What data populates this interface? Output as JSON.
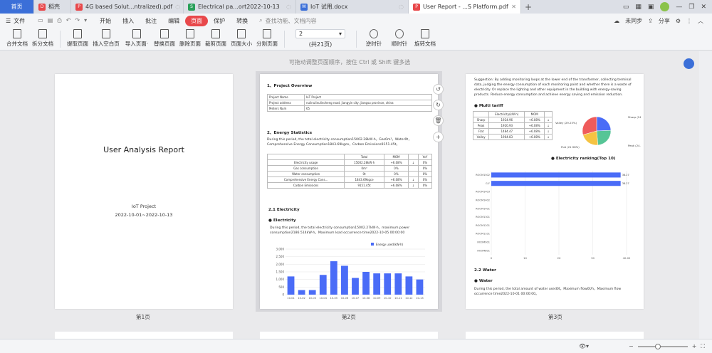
{
  "tabs": [
    {
      "label": "首页",
      "type": "home"
    },
    {
      "label": "稻壳",
      "icon_color": "#e8484b"
    },
    {
      "label": "4G based Solut...ntralized).pdf",
      "icon_color": "#e8484b"
    },
    {
      "label": "Electrical pa...ort2022-10-13",
      "icon_color": "#2aa05a"
    },
    {
      "label": "IoT 试用.docx",
      "icon_color": "#3b6fd8"
    },
    {
      "label": "User Report - ...S Platform.pdf",
      "icon_color": "#e8484b",
      "active": true
    }
  ],
  "menu": {
    "file": "文件",
    "items": [
      "开始",
      "插入",
      "批注",
      "编辑",
      "页面",
      "保护",
      "转换"
    ],
    "selected": "页面",
    "search_placeholder": "查找功能、文档内容",
    "sync": "未同步",
    "share": "分享"
  },
  "toolbar": {
    "buttons": [
      "合并文档",
      "拆分文档",
      "提取页面",
      "插入空白页",
      "导入页面·",
      "替换页面",
      "删除页面",
      "裁剪页面",
      "页面大小",
      "分割页面"
    ],
    "page_value": "2",
    "page_total": "(共21页)",
    "rotate": [
      "逆时针",
      "顺时针",
      "旋转文档"
    ]
  },
  "hint": "可拖动调整页面顺序，按住 Ctrl 或 Shift 键多选",
  "page1": {
    "title": "User Analysis Report",
    "project": "IoT Project",
    "range": "2022-10-01~2022-10-13",
    "label": "第1页"
  },
  "page2": {
    "label": "第2页",
    "s1": "1、Project Overview",
    "overview": [
      [
        "Project Name",
        "IoT Project"
      ],
      [
        "Project address",
        "nulinulinulincheng road, jiangyin city, jiangsu province, china"
      ],
      [
        "Meters Num",
        "65"
      ]
    ],
    "s2": "2、Energy Statistics",
    "stat_text": "During this period, the total electricity consumption15002.28kW·h，Gas0m³，Water0t，Comprehensive Energy Consumption1843.69kgce，Carbon Emissions9151.45t。",
    "stat_head": [
      "",
      "Total",
      "MOM",
      "",
      "YoY"
    ],
    "stat_rows": [
      [
        "Electricity usage",
        "15002.28kW·h",
        "+6.08%",
        "↓",
        "0%"
      ],
      [
        "Gas consumption",
        "0m³",
        "0%",
        "",
        "0%"
      ],
      [
        "Water consumption",
        "0t",
        "0%",
        "",
        "0%"
      ],
      [
        "Comprehensive Energy Cons...",
        "1843.69kgce",
        "+6.08%",
        "↓",
        "0%"
      ],
      [
        "Carbon Emissions",
        "9151.45t",
        "+6.08%",
        "↓",
        "0%"
      ]
    ],
    "s21": "2.1 Electricity",
    "bullet": "Electricity",
    "elec_text": "During this period, the total electricity consumption15002.27kW·h，maximum power consumption2186.514kW·h，Maximum load occurrence time2022-10-05 00:00:00",
    "legend": "Energy used(kW·h)"
  },
  "page3": {
    "label": "第3页",
    "suggestion": "Suggestion: By adding monitoring loops at the lower end of the transformer, collecting terminal data, judging the energy consumption of each monitoring point and whether there is a waste of electricity. Or replace the lighting and other equipment in the building with energy-saving products. Reduce energy consumption and achieve energy saving and emission reduction.",
    "tariff_title": "Multi tariff",
    "tariff_head": [
      "",
      "Electricity(kW·h)",
      "MOM",
      ""
    ],
    "tariff_rows": [
      [
        "Sharp",
        "1924.96",
        "+6.08%",
        "↓"
      ],
      [
        "Peak",
        "1920.93",
        "+6.08%",
        "↓"
      ],
      [
        "Flat",
        "1484.47",
        "+6.08%",
        "↓"
      ],
      [
        "Valley",
        "1964.83",
        "+6.08%",
        "↓"
      ]
    ],
    "ranking_title": "Electricity ranking(Top 10)",
    "s22": "2.2 Water",
    "water_bullet": "Water",
    "water_text": "During this period, the total amount of water used0t，Maximum flow0t/h，Maximum flow occurrence time2022-10-01 00:00:00。"
  },
  "chart_data": [
    {
      "type": "bar",
      "title": "",
      "legend": "Energy used(kW·h)",
      "categories": [
        "10-01",
        "10-02",
        "10-03",
        "10-04",
        "10-05",
        "10-06",
        "10-07",
        "10-08",
        "10-09",
        "10-10",
        "10-11",
        "10-12",
        "10-13"
      ],
      "values": [
        1200,
        300,
        300,
        1300,
        2200,
        1900,
        1100,
        1500,
        1400,
        1400,
        1400,
        1200,
        1000
      ],
      "ylim": [
        0,
        3000
      ],
      "yticks": [
        "0",
        "500",
        "1,000",
        "1,500",
        "2,000",
        "2,500",
        "3,000"
      ],
      "color": "#4a6cf7"
    },
    {
      "type": "pie",
      "labels": [
        "Sharp (24.25%)",
        "Peak (24.20%)",
        "Flat (21.98%)",
        "Valley (29.25%)"
      ],
      "values": [
        24.25,
        24.2,
        21.98,
        29.25
      ],
      "colors": [
        "#4a6cf7",
        "#56c596",
        "#f5c342",
        "#ef5b5b"
      ]
    },
    {
      "type": "bar",
      "orientation": "horizontal",
      "title": "Electricity ranking(Top 10)",
      "categories": [
        "ROOM1502",
        "G-F",
        "ROOM1403",
        "ROOM1402",
        "ROOM1401",
        "ROOM1301",
        "ROOM1201",
        "ROOM1101",
        "ROOM901",
        "ROOM801"
      ],
      "values": [
        38.27,
        38.27,
        0,
        0,
        0,
        0,
        0,
        0,
        0,
        0
      ],
      "data_labels": [
        "38.27",
        "38.27"
      ],
      "xticks": [
        "0",
        "10",
        "20",
        "30",
        "40.02"
      ],
      "color": "#4a6cf7"
    }
  ],
  "status": {
    "zoom_minus": "−",
    "zoom_plus": "+"
  }
}
